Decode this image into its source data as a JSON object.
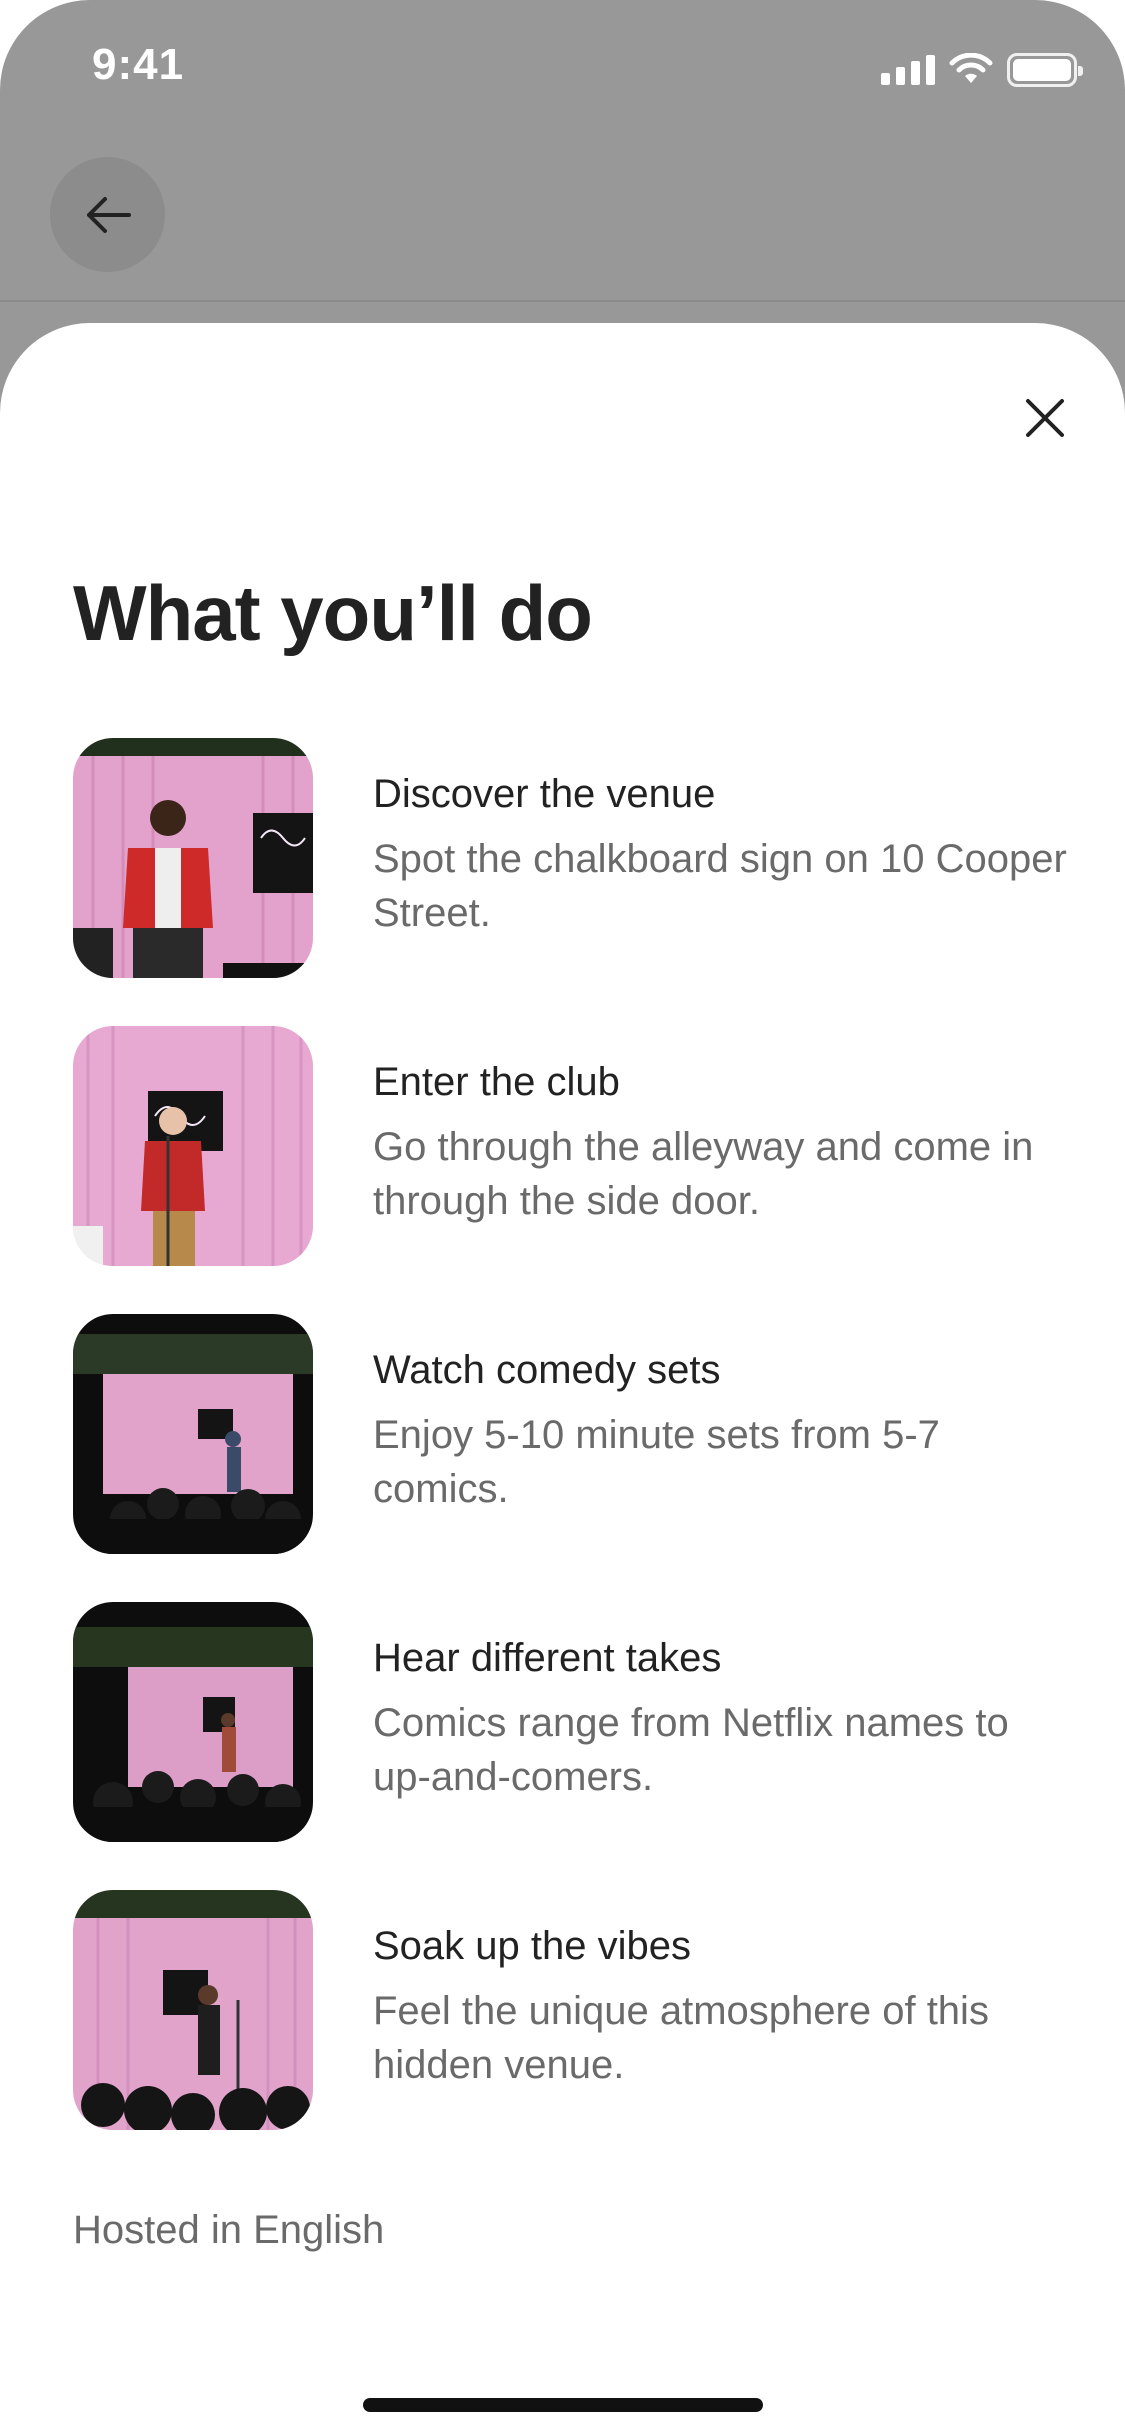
{
  "status_bar": {
    "time": "9:41"
  },
  "header": {
    "back_icon": "arrow-left-icon"
  },
  "modal": {
    "close_icon": "close-icon",
    "title": "What you’ll do",
    "items": [
      {
        "title": "Discover the venue",
        "description": "Spot the chalkboard sign on 10 Cooper Street.",
        "image": "comedian-with-mic-photo"
      },
      {
        "title": "Enter the club",
        "description": "Go through the alleyway and come in through the side door.",
        "image": "comedian-red-jacket-photo"
      },
      {
        "title": "Watch comedy sets",
        "description": "Enjoy 5-10 minute sets from 5-7 comics.",
        "image": "stage-with-audience-photo"
      },
      {
        "title": "Hear different takes",
        "description": "Comics range from Netflix names to up-and-comers.",
        "image": "stage-wide-shot-photo"
      },
      {
        "title": "Soak up the vibes",
        "description": "Feel the unique atmosphere of this hidden venue.",
        "image": "comedian-and-crowd-photo"
      }
    ],
    "footer_note": "Hosted in English"
  },
  "colors": {
    "text_primary": "#222222",
    "text_secondary": "#6a6a6a",
    "curtain_pink": "#e7a6cf",
    "backdrop": "#989898"
  }
}
